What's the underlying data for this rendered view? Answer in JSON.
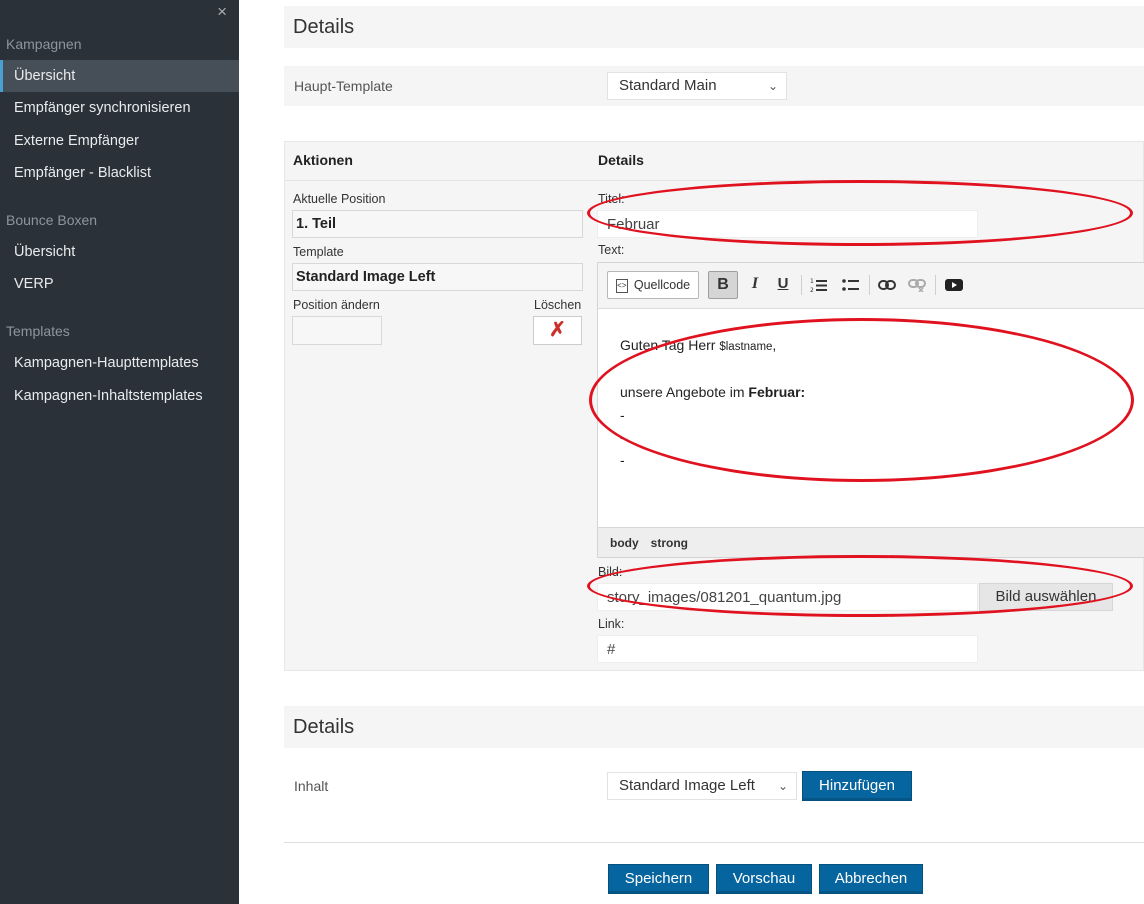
{
  "sidebar": {
    "close_glyph": "×",
    "groups": [
      {
        "title": "Kampagnen",
        "items": [
          "Übersicht",
          "Empfänger synchronisieren",
          "Externe Empfänger",
          "Empfänger - Blacklist"
        ]
      },
      {
        "title": "Bounce Boxen",
        "items": [
          "Übersicht",
          "VERP"
        ]
      },
      {
        "title": "Templates",
        "items": [
          "Kampagnen-Haupttemplates",
          "Kampagnen-Inhaltstemplates"
        ]
      }
    ],
    "active_item": "Übersicht"
  },
  "details1": {
    "heading": "Details",
    "main_template_label": "Haupt-Template",
    "main_template_value": "Standard Main"
  },
  "editor": {
    "col_actions": "Aktionen",
    "col_details": "Details",
    "current_position_label": "Aktuelle Position",
    "current_position_value": "1. Teil",
    "template_label": "Template",
    "template_value": "Standard Image Left",
    "change_position_label": "Position ändern",
    "delete_label": "Löschen",
    "title_label": "Titel:",
    "title_value": "Februar",
    "text_label": "Text:",
    "toolbar": {
      "source_label": "Quellcode",
      "bold": "B",
      "italic": "I",
      "underline": "U"
    },
    "content": {
      "greeting_prefix": "Guten Tag Herr ",
      "greeting_var": "$lastname",
      "greeting_suffix": ",",
      "offers_prefix": "unsere Angebote im ",
      "offers_bold": "Februar:",
      "dash1": "-",
      "dash2": "-",
      "dash3": "-"
    },
    "status_path": [
      "body",
      "strong"
    ],
    "image_label": "Bild:",
    "image_value": "story_images/081201_quantum.jpg",
    "image_button": "Bild auswählen",
    "link_label": "Link:",
    "link_value": "#"
  },
  "details2": {
    "heading": "Details",
    "content_label": "Inhalt",
    "content_value": "Standard Image Left",
    "add_button": "Hinzufügen"
  },
  "footer": {
    "save": "Speichern",
    "preview": "Vorschau",
    "cancel": "Abbrechen"
  },
  "colors": {
    "sidebar_bg": "#2b3138",
    "primary_button": "#06649e",
    "highlight_ring": "#e0121f"
  }
}
